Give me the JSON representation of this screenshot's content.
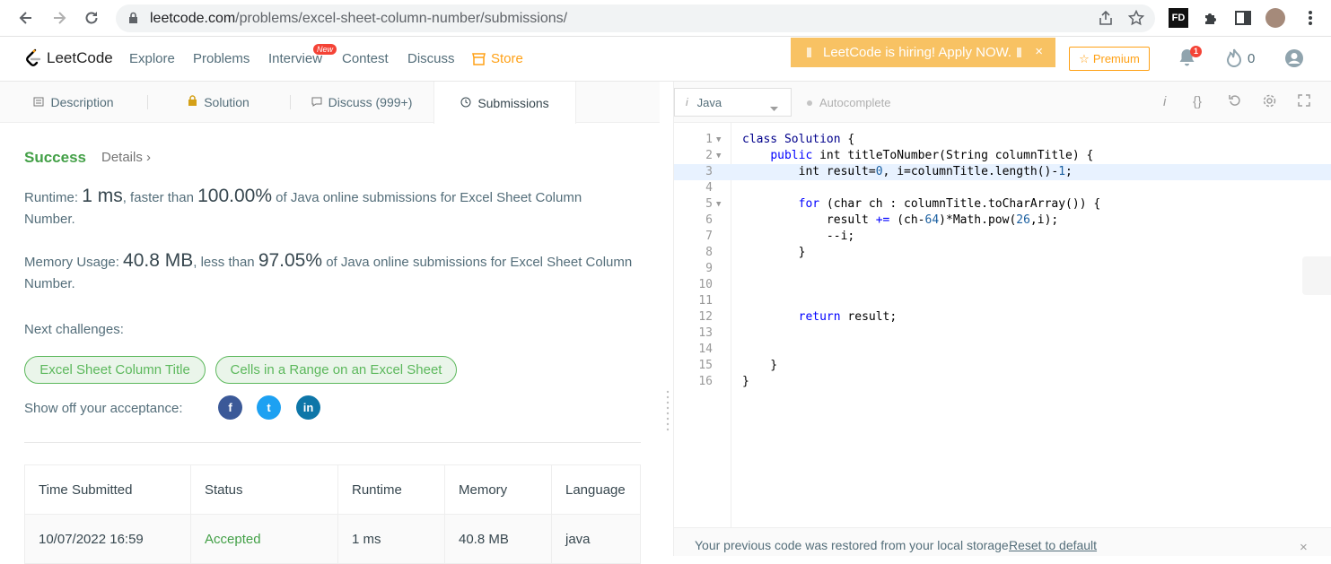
{
  "browser": {
    "url_host": "leetcode.com",
    "url_path": "/problems/excel-sheet-column-number/submissions/"
  },
  "navbar": {
    "logo": "LeetCode",
    "links": [
      "Explore",
      "Problems",
      "Interview",
      "Contest",
      "Discuss",
      "Store"
    ],
    "new_badge": "New",
    "hiring": "LeetCode is hiring! Apply NOW.",
    "hiring_close": "×",
    "premium": "Premium",
    "notification_count": "1",
    "streak": "0"
  },
  "tabs": {
    "description": "Description",
    "solution": "Solution",
    "discuss": "Discuss (999+)",
    "submissions": "Submissions"
  },
  "result": {
    "status": "Success",
    "details": "Details ›",
    "runtime_label": "Runtime: ",
    "runtime": "1 ms",
    "runtime_mid": ", faster than ",
    "runtime_pct": "100.00%",
    "runtime_tail": " of Java online submissions for Excel Sheet Column Number.",
    "memory_label": "Memory Usage: ",
    "memory": "40.8 MB",
    "memory_mid": ", less than ",
    "memory_pct": "97.05%",
    "memory_tail": " of Java online submissions for Excel Sheet Column Number."
  },
  "challenges": {
    "label": "Next challenges:",
    "items": [
      "Excel Sheet Column Title",
      "Cells in a Range on an Excel Sheet"
    ]
  },
  "share": {
    "label": "Show off your acceptance:",
    "facebook": "f",
    "twitter": "t",
    "linkedin": "in"
  },
  "submissions_table": {
    "headers": [
      "Time Submitted",
      "Status",
      "Runtime",
      "Memory",
      "Language"
    ],
    "rows": [
      [
        "10/07/2022 16:59",
        "Accepted",
        "1 ms",
        "40.8 MB",
        "java"
      ]
    ]
  },
  "editor": {
    "language": "Java",
    "autocomplete": "Autocomplete",
    "restore_message": "Your previous code was restored from your local storage.",
    "reset_link": "Reset to default",
    "restore_close": "×",
    "line_numbers": [
      "1",
      "2",
      "3",
      "4",
      "5",
      "6",
      "7",
      "8",
      "9",
      "10",
      "11",
      "12",
      "13",
      "14",
      "15",
      "16"
    ]
  },
  "colors": {
    "accent": "#ffa116",
    "success": "#43a047",
    "pill_green": "#5cb85c",
    "hiring_bg": "#f8c263",
    "facebook": "#3b5998",
    "twitter": "#1da1f2",
    "linkedin": "#0e76a8"
  }
}
